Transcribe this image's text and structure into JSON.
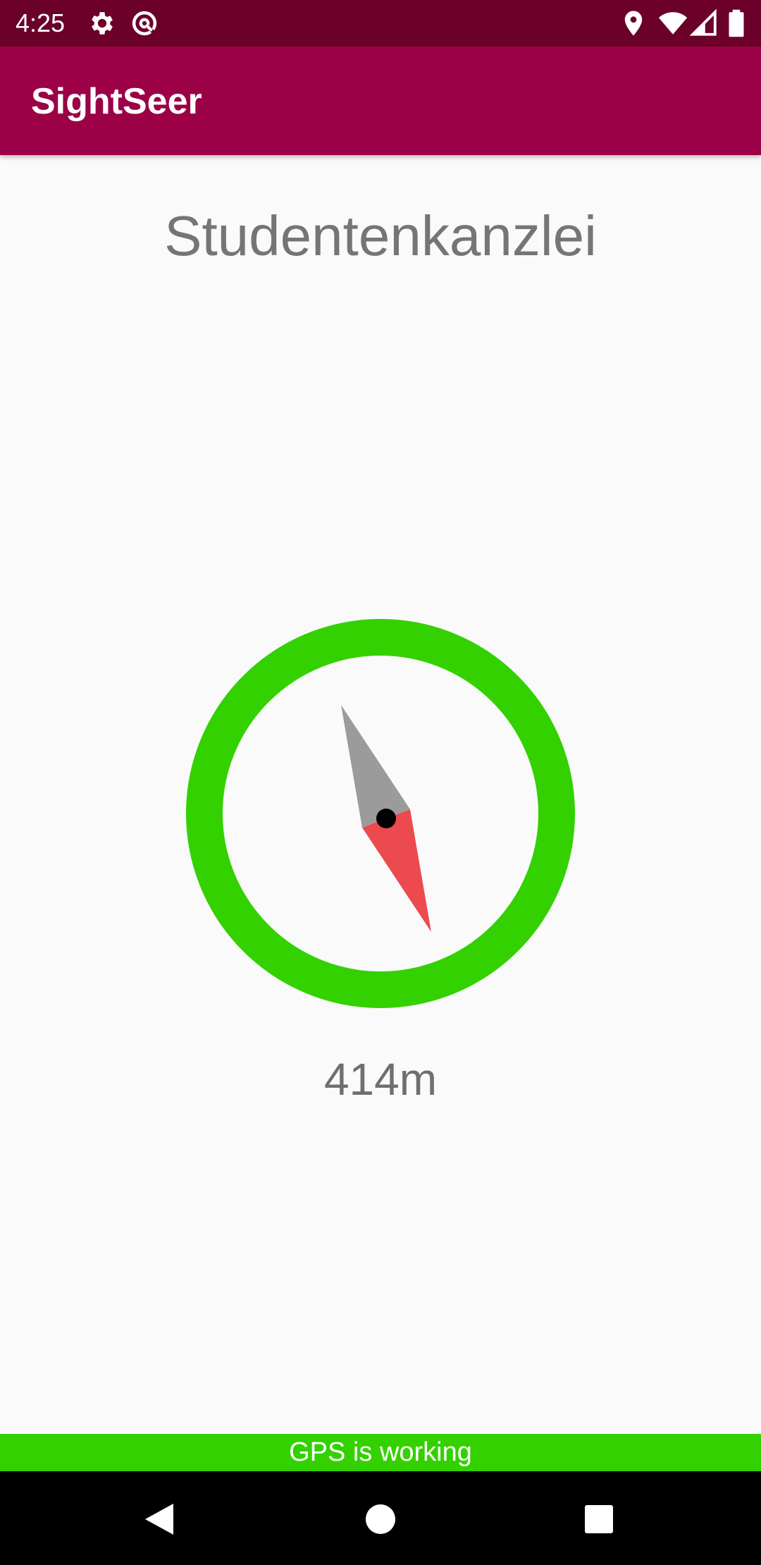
{
  "status_bar": {
    "time": "4:25",
    "left_icons": [
      "gear-icon",
      "data-saver-icon"
    ],
    "right_icons": [
      "location-icon",
      "wifi-icon",
      "signal-icon",
      "battery-icon"
    ],
    "background": "#6b0029"
  },
  "app_bar": {
    "title": "SightSeer",
    "background": "#9c0046"
  },
  "destination": {
    "name": "Studentenkanzlei"
  },
  "compass": {
    "ring_color": "#33d100",
    "needle_north_color": "#9b9b9b",
    "needle_south_color": "#ec4a4f",
    "heading_deg": 160
  },
  "distance": {
    "text": "414m"
  },
  "gps_status": {
    "text": "GPS is working",
    "color": "#33d100"
  },
  "nav_bar": {
    "buttons": [
      "back-icon",
      "home-icon",
      "recents-icon"
    ]
  }
}
